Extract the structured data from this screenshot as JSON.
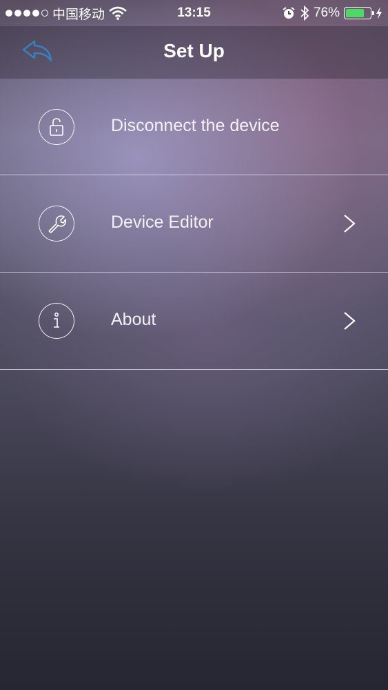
{
  "status_bar": {
    "carrier": "中国移动",
    "time": "13:15",
    "battery_percent": "76%",
    "battery_level": 0.76,
    "battery_color": "#4cd964"
  },
  "nav": {
    "title": "Set Up",
    "back_icon": "back-arrow-icon",
    "accent_color": "#3a7fc0"
  },
  "menu": {
    "items": [
      {
        "label": "Disconnect the device",
        "icon": "unlock-icon",
        "has_chevron": false
      },
      {
        "label": "Device Editor",
        "icon": "wrench-icon",
        "has_chevron": true
      },
      {
        "label": "About",
        "icon": "info-icon",
        "has_chevron": true
      }
    ]
  }
}
